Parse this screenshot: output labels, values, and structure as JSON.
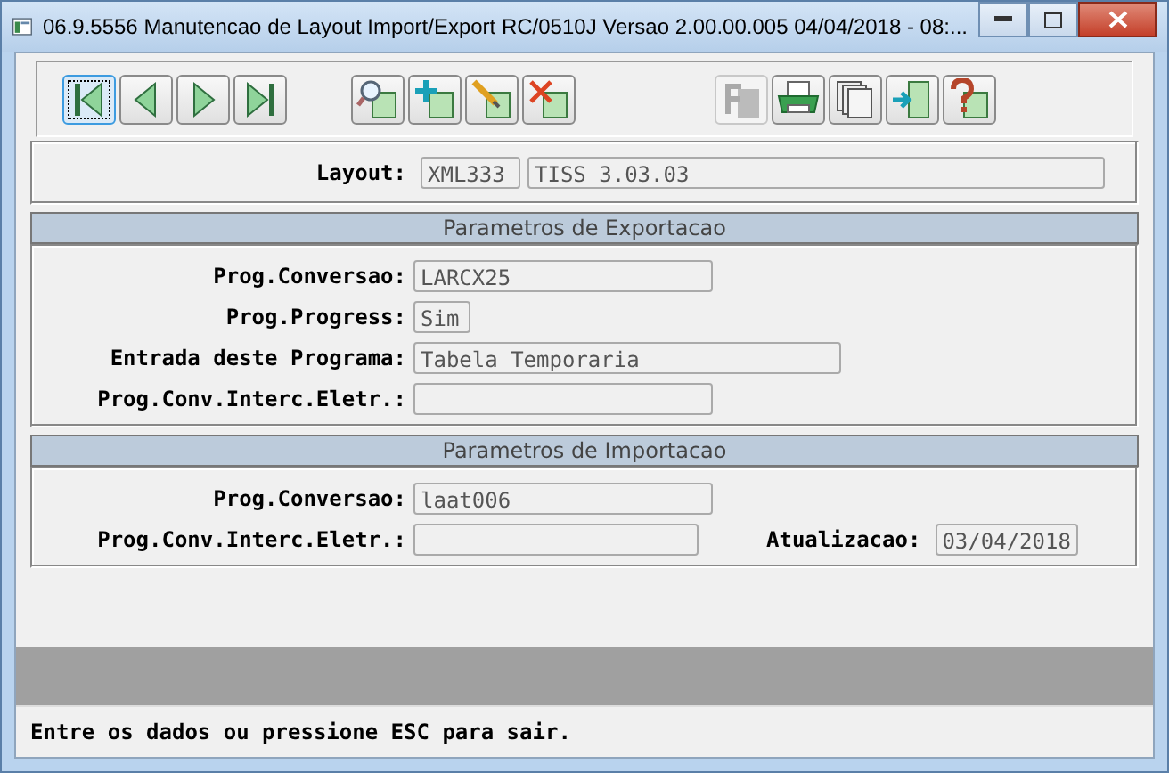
{
  "window": {
    "title": "06.9.5556 Manutencao  de Layout Import/Export RC/0510J Versao 2.00.00.005 04/04/2018 - 08:..."
  },
  "toolbar": [
    {
      "kind": "first",
      "focused": true,
      "disabled": false
    },
    {
      "kind": "prev",
      "focused": false,
      "disabled": false
    },
    {
      "kind": "next",
      "focused": false,
      "disabled": false
    },
    {
      "kind": "last",
      "focused": false,
      "disabled": false
    },
    {
      "kind": "search",
      "focused": false,
      "disabled": false
    },
    {
      "kind": "add",
      "focused": false,
      "disabled": false
    },
    {
      "kind": "edit",
      "focused": false,
      "disabled": false
    },
    {
      "kind": "delete",
      "focused": false,
      "disabled": false
    },
    {
      "kind": "filter",
      "focused": false,
      "disabled": true
    },
    {
      "kind": "print",
      "focused": false,
      "disabled": false
    },
    {
      "kind": "copy",
      "focused": false,
      "disabled": false
    },
    {
      "kind": "exit",
      "focused": false,
      "disabled": false
    },
    {
      "kind": "help",
      "focused": false,
      "disabled": false
    }
  ],
  "layout": {
    "label": "Layout:",
    "code": "XML333",
    "description": "TISS 3.03.03"
  },
  "export": {
    "title": "Parametros de Exportacao",
    "fields": [
      {
        "label": "Prog.Conversao:",
        "value": "LARCX25"
      },
      {
        "label": "Prog.Progress:",
        "value": "Sim"
      },
      {
        "label": "Entrada deste Programa:",
        "value": "Tabela Temporaria"
      },
      {
        "label": "Prog.Conv.Interc.Eletr.:"
      }
    ]
  },
  "import": {
    "title": "Parametros de Importacao",
    "fields": [
      {
        "label": "Prog.Conversao:",
        "value": "laat006"
      },
      {
        "label": "Prog.Conv.Interc.Eletr.:"
      }
    ],
    "update": {
      "label": "Atualizacao:",
      "value": "03/04/2018"
    }
  },
  "status_bar": "Entre os dados ou pressione ESC para sair."
}
